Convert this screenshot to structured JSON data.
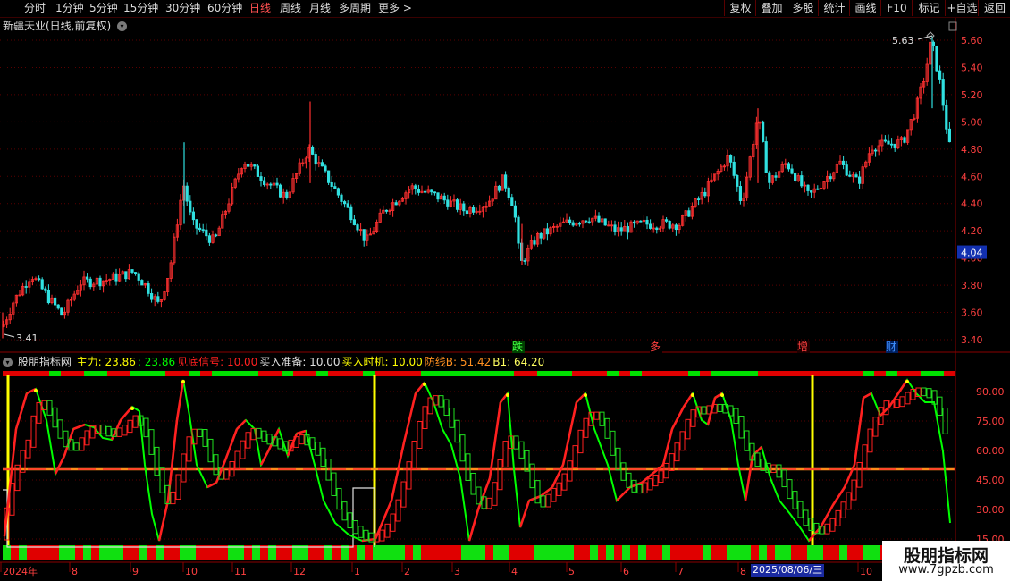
{
  "topbar": {
    "periods": [
      "分时",
      "1分钟",
      "5分钟",
      "15分钟",
      "30分钟",
      "60分钟",
      "日线",
      "周线",
      "月线",
      "多周期",
      "更多"
    ],
    "active": "日线",
    "more_arrow": ">",
    "right_buttons": [
      "复权",
      "叠加",
      "多股",
      "统计",
      "画线",
      "F10",
      "标记",
      "+自选",
      "返回"
    ]
  },
  "stock_title": "新疆天业(日线,前复权)",
  "price_axis": {
    "labels": [
      "5.60",
      "5.40",
      "5.20",
      "5.00",
      "4.80",
      "4.60",
      "4.40",
      "4.20",
      "4.00",
      "3.80",
      "3.60",
      "3.40"
    ],
    "current": "4.04"
  },
  "annotations": {
    "high": "5.63",
    "low": "3.41"
  },
  "event_tags": [
    "跌",
    "多",
    "增",
    "财"
  ],
  "indicator": {
    "name": "股朋指标网",
    "items": [
      {
        "label": "主力:",
        "value": "23.86",
        "color": "#ffff00"
      },
      {
        "label": ":",
        "value": "23.86",
        "color": "#00ff00"
      },
      {
        "label": "见底信号:",
        "value": "10.00",
        "color": "#ff2020"
      },
      {
        "label": "买入准备:",
        "value": "10.00",
        "color": "#e0e0e0"
      },
      {
        "label": "买入时机:",
        "value": "10.00",
        "color": "#ffff00"
      },
      {
        "label": "防线B:",
        "value": "51.42",
        "color": "#ff9020"
      },
      {
        "label": "B1:",
        "value": "64.20",
        "color": "#ffff60"
      }
    ],
    "axis": [
      "90.00",
      "75.00",
      "60.00",
      "45.00",
      "30.00",
      "15.00"
    ]
  },
  "x_axis": {
    "labels": [
      "2024年",
      "8",
      "9",
      "10",
      "11",
      "12",
      "1",
      "2",
      "3",
      "4",
      "5",
      "6",
      "7",
      "8",
      "10"
    ],
    "cursor_date": "2025/08/06/三"
  },
  "watermark": {
    "line1": "股朋指标网",
    "line2": "www.7gpzb.com"
  },
  "colors": {
    "up": "#ff3030",
    "down": "#30e0e0",
    "main_line": "#00ff00",
    "ref_line": "#ff3030",
    "defense": "#ff8c1a",
    "signal": "#ffff00"
  }
}
